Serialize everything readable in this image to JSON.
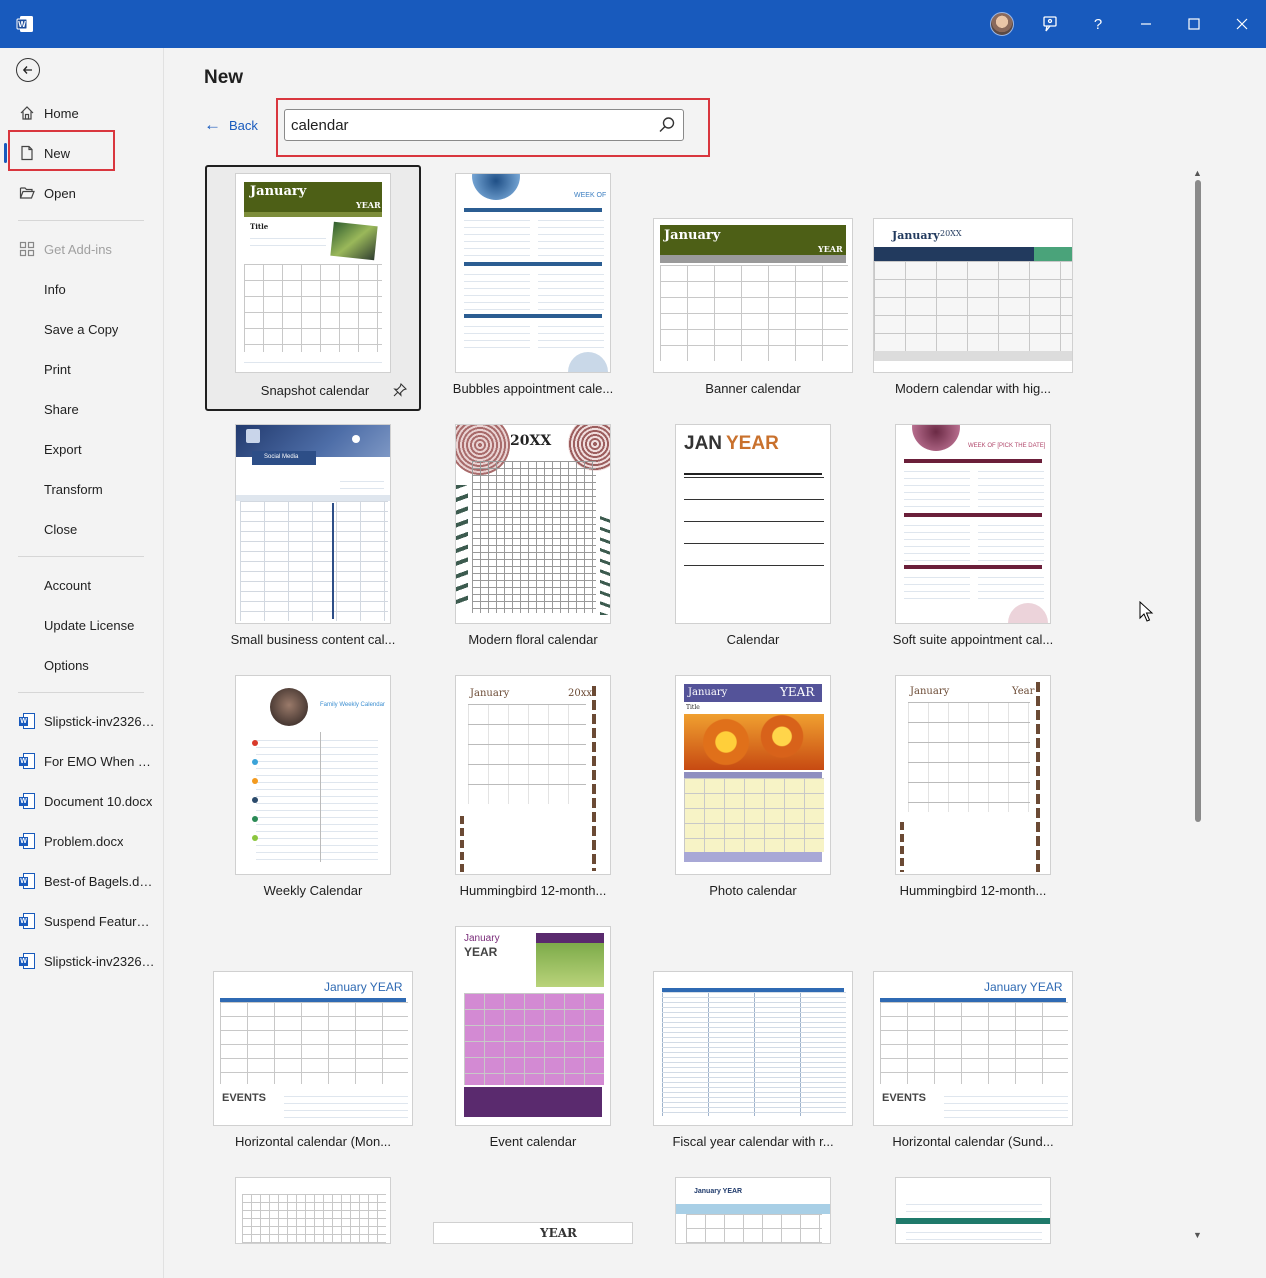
{
  "titlebar": {
    "help_label": "?",
    "colors": {
      "bar": "#185abd"
    }
  },
  "sidebar": {
    "items": [
      {
        "label": "Home",
        "icon": "home-icon"
      },
      {
        "label": "New",
        "icon": "new-document-icon",
        "selected": true
      },
      {
        "label": "Open",
        "icon": "folder-open-icon"
      },
      {
        "label": "Get Add-ins",
        "icon": "add-ins-icon",
        "disabled": true
      },
      {
        "label": "Info"
      },
      {
        "label": "Save a Copy"
      },
      {
        "label": "Print"
      },
      {
        "label": "Share"
      },
      {
        "label": "Export"
      },
      {
        "label": "Transform"
      },
      {
        "label": "Close"
      },
      {
        "label": "Account"
      },
      {
        "label": "Update License"
      },
      {
        "label": "Options"
      }
    ],
    "recent": [
      "Slipstick-inv23266-...",
      "For EMO When will...",
      "Document 10.docx",
      "Problem.docx",
      "Best-of Bagels.docx",
      "Suspend Feature G...",
      "Slipstick-inv23265-..."
    ]
  },
  "main": {
    "title": "New",
    "back_label": "Back",
    "search_value": "calendar",
    "templates": [
      "Snapshot calendar",
      "Bubbles appointment cale...",
      "Banner calendar",
      "Modern calendar with hig...",
      "Small business content cal...",
      "Modern floral calendar",
      "Calendar",
      "Soft suite appointment cal...",
      "Weekly Calendar",
      "Hummingbird 12-month...",
      "Photo calendar",
      "Hummingbird 12-month...",
      "Horizontal calendar (Mon...",
      "Event calendar",
      "Fiscal year calendar with r...",
      "Horizontal calendar (Sund..."
    ],
    "thumb_text": {
      "january": "January",
      "year": "YEAR",
      "year_lower": "Year",
      "week_of": "WEEK OF",
      "week_of_date": "WEEK OF [PICK THE DATE]",
      "social_media": "Social Media",
      "twenty_xx": "20XX",
      "twenty_xx_lower": "20xx",
      "jan": "JAN",
      "family_weekly": "Family Weekly Calendar",
      "events": "EVENTS",
      "january_year": "January YEAR",
      "title": "Title",
      "sixx": "20XX"
    }
  }
}
